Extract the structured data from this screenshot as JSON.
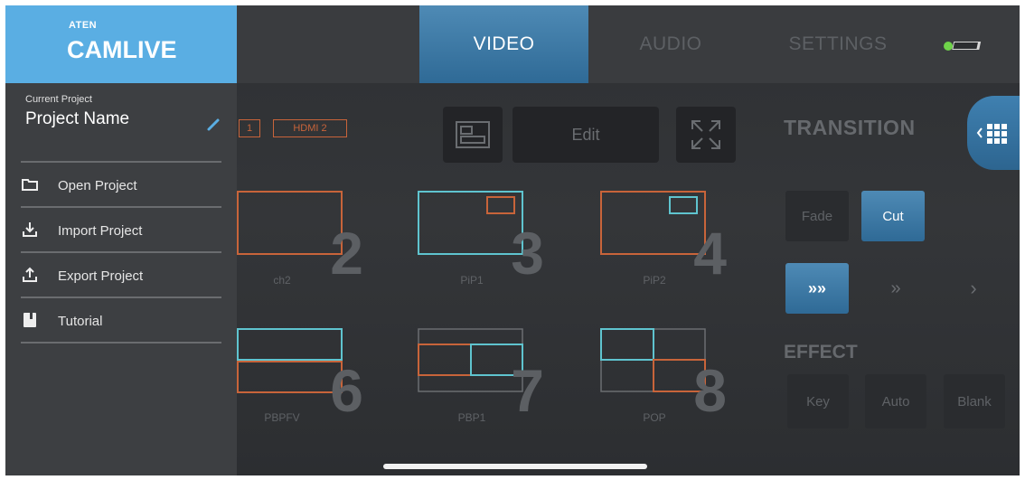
{
  "sidebar": {
    "brand_small": "ATEN",
    "brand_name": "CAMLIVE",
    "current_project_label": "Current Project",
    "project_name": "Project Name",
    "menu": [
      {
        "label": "Open Project",
        "icon": "folder-icon"
      },
      {
        "label": "Import Project",
        "icon": "import-icon"
      },
      {
        "label": "Export Project",
        "icon": "export-icon"
      },
      {
        "label": "Tutorial",
        "icon": "book-icon"
      }
    ]
  },
  "tabs": {
    "video": "VIDEO",
    "audio": "AUDIO",
    "settings": "SETTINGS"
  },
  "sources": {
    "s1": "1",
    "s2": "HDMI 2"
  },
  "edit_label": "Edit",
  "layouts": [
    {
      "number": "2",
      "label": "ch2"
    },
    {
      "number": "3",
      "label": "PiP1"
    },
    {
      "number": "4",
      "label": "PiP2"
    },
    {
      "number": "6",
      "label": "PBPFV"
    },
    {
      "number": "7",
      "label": "PBP1"
    },
    {
      "number": "8",
      "label": "POP"
    }
  ],
  "transition": {
    "title": "TRANSITION",
    "fade": "Fade",
    "cut": "Cut",
    "speed_fast": "»»",
    "speed_medium": "»",
    "speed_slow": "›"
  },
  "effect": {
    "title": "EFFECT",
    "key": "Key",
    "auto": "Auto",
    "blank": "Blank"
  },
  "colors": {
    "accent": "#4e8ab5",
    "brand": "#5aaee3",
    "orange": "#c8643a",
    "cyan": "#5fc4cf"
  }
}
